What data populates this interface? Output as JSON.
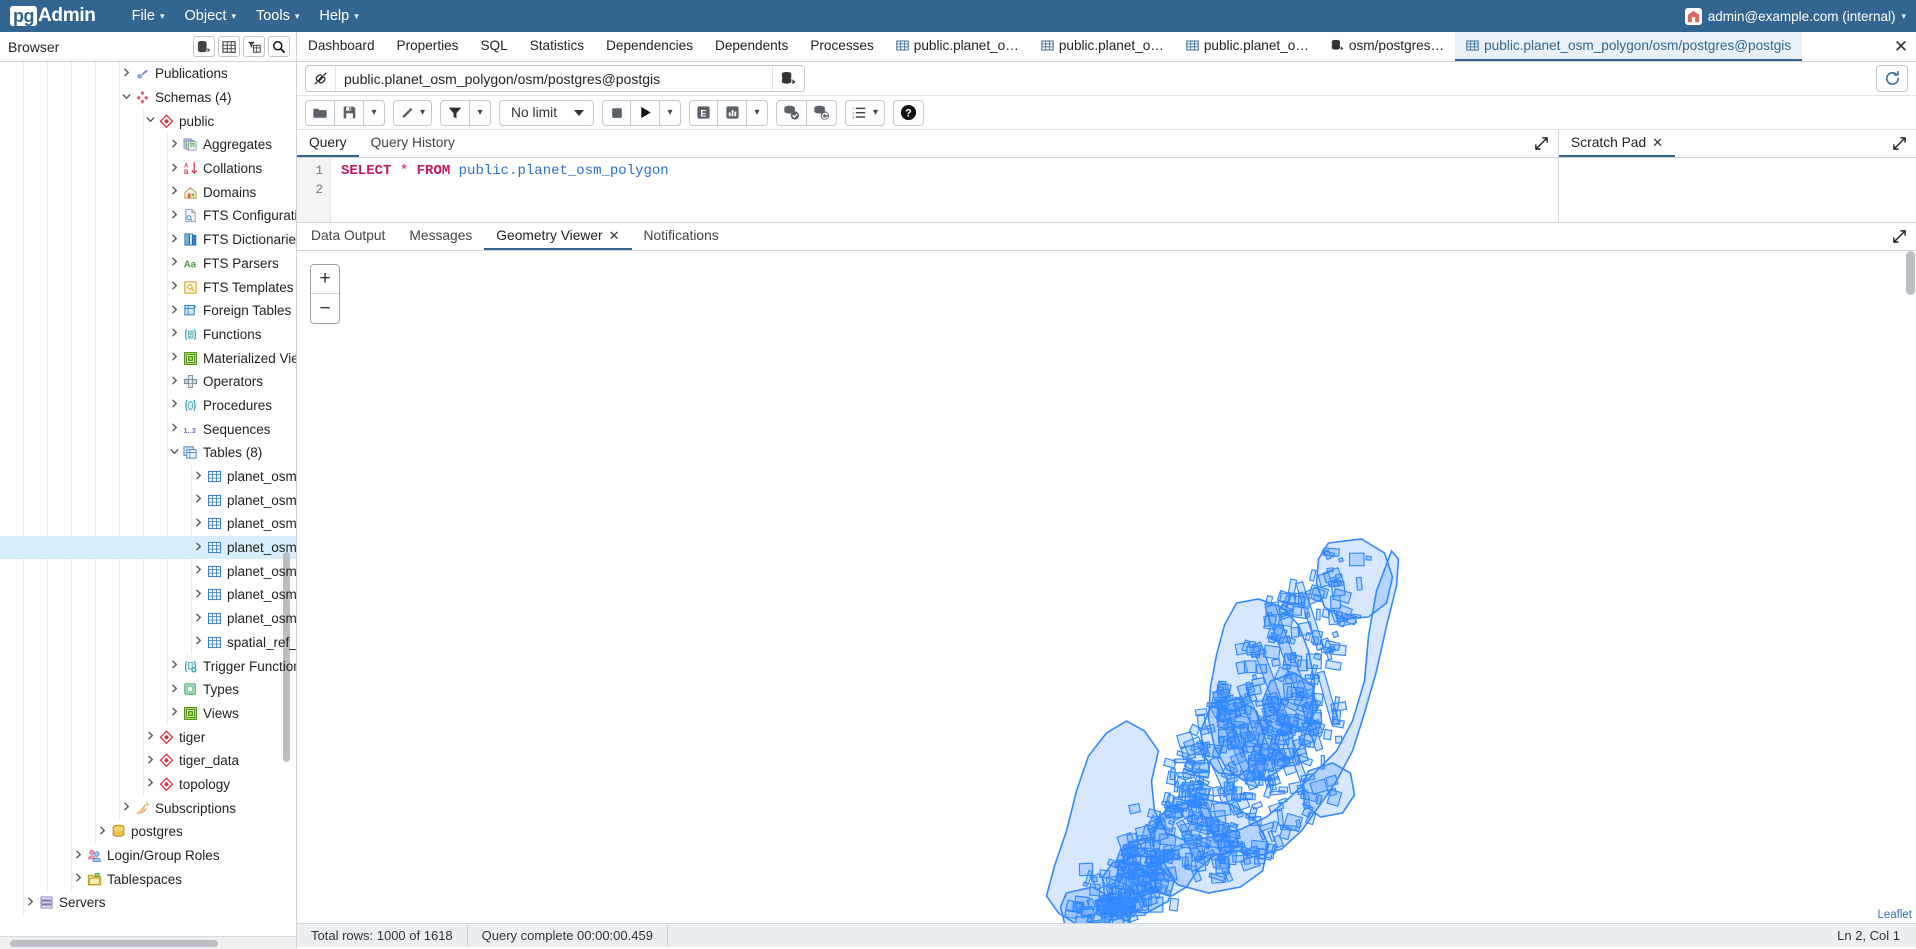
{
  "app": {
    "logo_pg": "pg",
    "logo_admin": "Admin",
    "menus": [
      {
        "label": "File",
        "icon": "chevron-down-icon"
      },
      {
        "label": "Object",
        "icon": "chevron-down-icon"
      },
      {
        "label": "Tools",
        "icon": "chevron-down-icon"
      },
      {
        "label": "Help",
        "icon": "chevron-down-icon"
      }
    ],
    "user": "admin@example.com (internal)"
  },
  "browser": {
    "title": "Browser",
    "buttons": [
      "object-explorer-icon",
      "grid-icon",
      "filter-table-icon",
      "search-icon"
    ]
  },
  "tabs": [
    {
      "label": "Dashboard",
      "icon": "",
      "active": false
    },
    {
      "label": "Properties",
      "icon": "",
      "active": false
    },
    {
      "label": "SQL",
      "icon": "",
      "active": false
    },
    {
      "label": "Statistics",
      "icon": "",
      "active": false
    },
    {
      "label": "Dependencies",
      "icon": "",
      "active": false
    },
    {
      "label": "Dependents",
      "icon": "",
      "active": false
    },
    {
      "label": "Processes",
      "icon": "",
      "active": false
    },
    {
      "label": "public.planet_o…",
      "icon": "table-icon",
      "active": false
    },
    {
      "label": "public.planet_o…",
      "icon": "table-icon",
      "active": false
    },
    {
      "label": "public.planet_o…",
      "icon": "table-icon",
      "active": false
    },
    {
      "label": "osm/postgres…",
      "icon": "database-icon",
      "active": false
    },
    {
      "label": "public.planet_osm_polygon/osm/postgres@postgis",
      "icon": "table-icon",
      "active": true
    }
  ],
  "tab_close_icon": "close-icon",
  "tree": [
    {
      "label": "Publications",
      "depth": 5,
      "arrow": "right",
      "icon": "publication-icon",
      "selected": false
    },
    {
      "label": "Schemas (4)",
      "depth": 5,
      "arrow": "down",
      "icon": "schemas-icon",
      "selected": false
    },
    {
      "label": "public",
      "depth": 6,
      "arrow": "down",
      "icon": "schema-icon",
      "selected": false
    },
    {
      "label": "Aggregates",
      "depth": 7,
      "arrow": "right",
      "icon": "aggregates-icon",
      "selected": false
    },
    {
      "label": "Collations",
      "depth": 7,
      "arrow": "right",
      "icon": "collations-icon",
      "selected": false
    },
    {
      "label": "Domains",
      "depth": 7,
      "arrow": "right",
      "icon": "domains-icon",
      "selected": false
    },
    {
      "label": "FTS Configurations",
      "depth": 7,
      "arrow": "right",
      "icon": "fts-configurations-icon",
      "selected": false
    },
    {
      "label": "FTS Dictionaries",
      "depth": 7,
      "arrow": "right",
      "icon": "fts-dictionaries-icon",
      "selected": false
    },
    {
      "label": "FTS Parsers",
      "depth": 7,
      "arrow": "right",
      "icon": "fts-parsers-icon",
      "selected": false
    },
    {
      "label": "FTS Templates",
      "depth": 7,
      "arrow": "right",
      "icon": "fts-templates-icon",
      "selected": false
    },
    {
      "label": "Foreign Tables",
      "depth": 7,
      "arrow": "right",
      "icon": "foreign-tables-icon",
      "selected": false
    },
    {
      "label": "Functions",
      "depth": 7,
      "arrow": "right",
      "icon": "functions-icon",
      "selected": false
    },
    {
      "label": "Materialized Views",
      "depth": 7,
      "arrow": "right",
      "icon": "materialized-views-icon",
      "selected": false
    },
    {
      "label": "Operators",
      "depth": 7,
      "arrow": "right",
      "icon": "operators-icon",
      "selected": false
    },
    {
      "label": "Procedures",
      "depth": 7,
      "arrow": "right",
      "icon": "procedures-icon",
      "selected": false
    },
    {
      "label": "Sequences",
      "depth": 7,
      "arrow": "right",
      "icon": "sequences-icon",
      "selected": false
    },
    {
      "label": "Tables (8)",
      "depth": 7,
      "arrow": "down",
      "icon": "tables-icon",
      "selected": false
    },
    {
      "label": "planet_osm_line",
      "depth": 8,
      "arrow": "right",
      "icon": "table-icon",
      "selected": false
    },
    {
      "label": "planet_osm_nodes",
      "depth": 8,
      "arrow": "right",
      "icon": "table-icon",
      "selected": false
    },
    {
      "label": "planet_osm_point",
      "depth": 8,
      "arrow": "right",
      "icon": "table-icon",
      "selected": false
    },
    {
      "label": "planet_osm_polygon",
      "depth": 8,
      "arrow": "right",
      "icon": "table-icon",
      "selected": true
    },
    {
      "label": "planet_osm_rels",
      "depth": 8,
      "arrow": "right",
      "icon": "table-icon",
      "selected": false
    },
    {
      "label": "planet_osm_roads",
      "depth": 8,
      "arrow": "right",
      "icon": "table-icon",
      "selected": false
    },
    {
      "label": "planet_osm_ways",
      "depth": 8,
      "arrow": "right",
      "icon": "table-icon",
      "selected": false
    },
    {
      "label": "spatial_ref_sys",
      "depth": 8,
      "arrow": "right",
      "icon": "table-icon",
      "selected": false
    },
    {
      "label": "Trigger Functions",
      "depth": 7,
      "arrow": "right",
      "icon": "trigger-functions-icon",
      "selected": false
    },
    {
      "label": "Types",
      "depth": 7,
      "arrow": "right",
      "icon": "types-icon",
      "selected": false
    },
    {
      "label": "Views",
      "depth": 7,
      "arrow": "right",
      "icon": "views-icon",
      "selected": false
    },
    {
      "label": "tiger",
      "depth": 6,
      "arrow": "right",
      "icon": "schema-icon",
      "selected": false
    },
    {
      "label": "tiger_data",
      "depth": 6,
      "arrow": "right",
      "icon": "schema-icon",
      "selected": false
    },
    {
      "label": "topology",
      "depth": 6,
      "arrow": "right",
      "icon": "schema-icon",
      "selected": false
    },
    {
      "label": "Subscriptions",
      "depth": 5,
      "arrow": "right",
      "icon": "subscriptions-icon",
      "selected": false
    },
    {
      "label": "postgres",
      "depth": 4,
      "arrow": "right",
      "icon": "database-icon",
      "selected": false
    },
    {
      "label": "Login/Group Roles",
      "depth": 3,
      "arrow": "right",
      "icon": "roles-icon",
      "selected": false
    },
    {
      "label": "Tablespaces",
      "depth": 3,
      "arrow": "right",
      "icon": "tablespaces-icon",
      "selected": false
    },
    {
      "label": "Servers",
      "depth": 1,
      "arrow": "right",
      "icon": "servers-icon",
      "selected": false
    }
  ],
  "connection": {
    "icon": "connection-icon",
    "value": "public.planet_osm_polygon/osm/postgres@postgis",
    "placeholder": "Connection string",
    "switch_icon": "database-switch-icon",
    "refresh_icon": "refresh-icon"
  },
  "toolbar": {
    "open_file": "open-file-icon",
    "save_file": "save-file-icon",
    "save_caret": "chevron-down-icon",
    "edit": "pencil-icon",
    "edit_caret": "chevron-down-icon",
    "filter": "filter-icon",
    "filter_caret": "chevron-down-icon",
    "limit_label": "No limit",
    "limit_caret": "dropdown-caret-icon",
    "stop": "stop-icon",
    "execute": "play-icon",
    "execute_caret": "chevron-down-icon",
    "explain": "explain-icon",
    "explain_analyze": "explain-analyze-icon",
    "explain_caret": "chevron-down-icon",
    "commit": "commit-icon",
    "rollback": "rollback-icon",
    "macros": "macros-list-icon",
    "macros_caret": "chevron-down-icon",
    "help": "help-icon"
  },
  "editor": {
    "tabs": [
      {
        "label": "Query",
        "active": true
      },
      {
        "label": "Query History",
        "active": false
      }
    ],
    "expand_icon": "expand-icon",
    "lines": [
      "1",
      "2"
    ],
    "sql": {
      "keyword1": "SELECT",
      "star": "*",
      "keyword2": "FROM",
      "schema": "public",
      "dot": ".",
      "table": "planet_osm_polygon"
    }
  },
  "scratchpad": {
    "label": "Scratch Pad",
    "close_icon": "close-icon",
    "expand_icon": "expand-icon",
    "value": ""
  },
  "output": {
    "tabs": [
      {
        "label": "Data Output",
        "active": false,
        "closable": false
      },
      {
        "label": "Messages",
        "active": false,
        "closable": false
      },
      {
        "label": "Geometry Viewer",
        "active": true,
        "closable": true
      },
      {
        "label": "Notifications",
        "active": false,
        "closable": false
      }
    ],
    "close_icon": "close-icon",
    "expand_icon": "expand-icon"
  },
  "map": {
    "zoom_in": "+",
    "zoom_out": "−",
    "attribution": "Leaflet",
    "stroke_color": "#3388ff",
    "fill_color": "#3388ff"
  },
  "status": {
    "total_rows": "Total rows: 1000 of 1618",
    "query_time": "Query complete 00:00:00.459",
    "cursor": "Ln 2, Col 1"
  }
}
